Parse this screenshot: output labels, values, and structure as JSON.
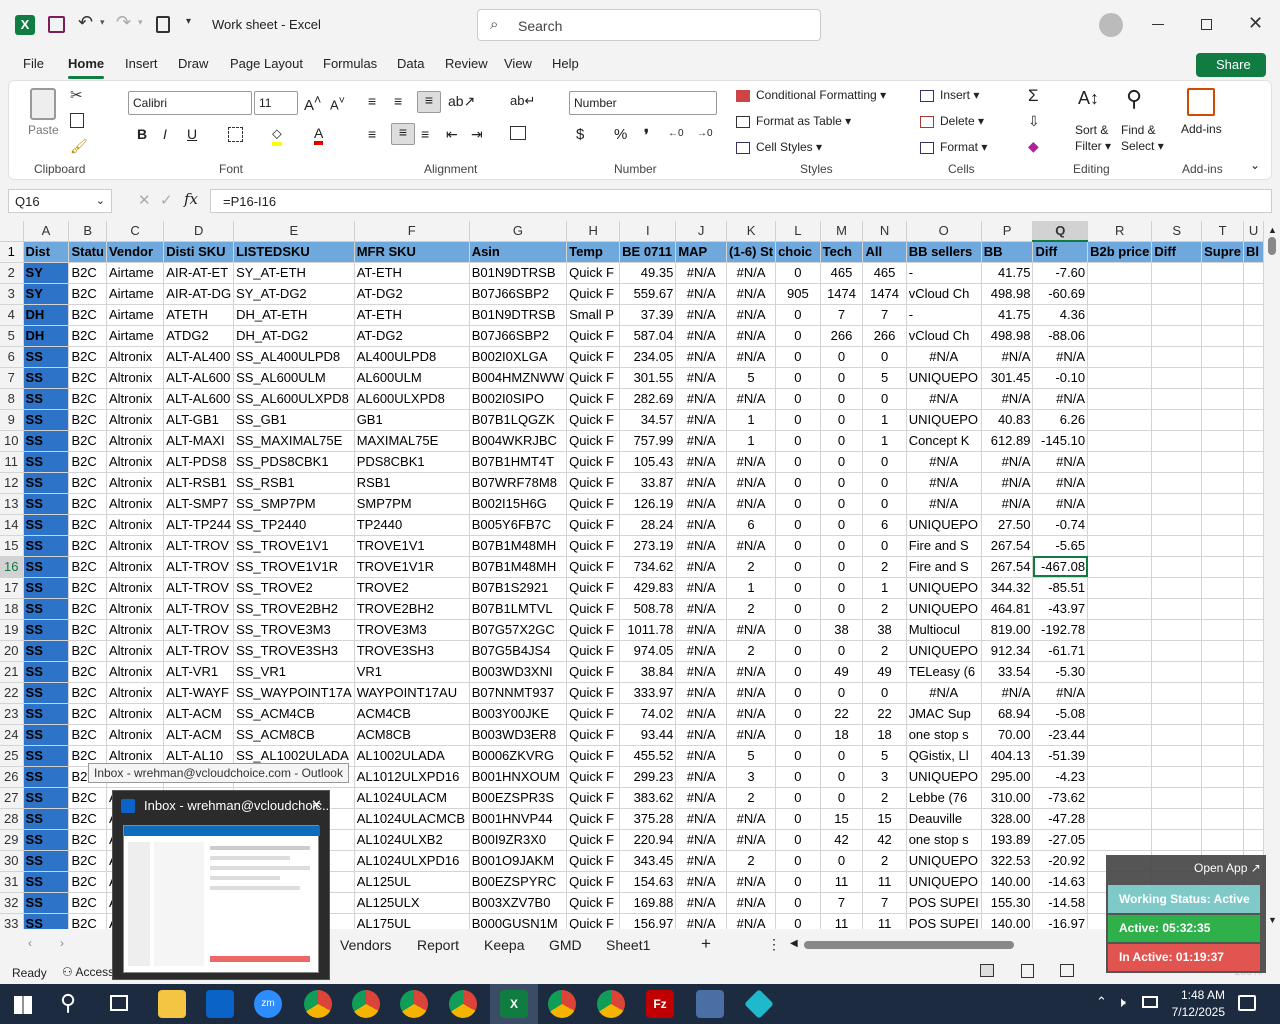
{
  "titlebar": {
    "doc_title": "Work sheet  -  Excel",
    "search_placeholder": "Search"
  },
  "menu": [
    "File",
    "Home",
    "Insert",
    "Draw",
    "Page Layout",
    "Formulas",
    "Data",
    "Review",
    "View",
    "Help"
  ],
  "share": "Share",
  "ribbon": {
    "paste": "Paste",
    "font_name": "Calibri",
    "font_size": "11",
    "number_format": "Number",
    "cond_fmt": "Conditional Formatting",
    "fmt_table": "Format as Table",
    "cell_styles": "Cell Styles",
    "insert": "Insert",
    "delete": "Delete",
    "format": "Format",
    "sort": "Sort &",
    "filter": "Filter",
    "find": "Find &",
    "select": "Select",
    "addins": "Add-ins",
    "groups": {
      "clipboard": "Clipboard",
      "font": "Font",
      "alignment": "Alignment",
      "number": "Number",
      "styles": "Styles",
      "cells": "Cells",
      "editing": "Editing",
      "addins": "Add-ins"
    }
  },
  "formula_bar": {
    "name_box": "Q16",
    "formula": "=P16-I16"
  },
  "columns": [
    "A",
    "B",
    "C",
    "D",
    "E",
    "F",
    "G",
    "H",
    "I",
    "J",
    "K",
    "L",
    "M",
    "N",
    "O",
    "P",
    "Q",
    "R",
    "S",
    "T",
    "U"
  ],
  "header_row": [
    "Dist",
    "Statu",
    "Vendor",
    "Disti SKU",
    "LISTEDSKU",
    "MFR SKU",
    "Asin",
    "Temp",
    "BE 0711",
    "MAP",
    "(1-6) St",
    "choic",
    "Tech",
    "All",
    "BB sellers",
    "BB",
    "Diff",
    "B2b price",
    "Diff",
    "Supre",
    "Bl"
  ],
  "rows": [
    [
      "SY",
      "B2C",
      "Airtame",
      "AIR-AT-ET",
      "SY_AT-ETH",
      "AT-ETH",
      "B01N9DTRSB",
      "Quick F",
      "49.35",
      "#N/A",
      "#N/A",
      "0",
      "465",
      "465",
      "-",
      "41.75",
      "-7.60"
    ],
    [
      "SY",
      "B2C",
      "Airtame",
      "AIR-AT-DG",
      "SY_AT-DG2",
      "AT-DG2",
      "B07J66SBP2",
      "Quick F",
      "559.67",
      "#N/A",
      "#N/A",
      "905",
      "1474",
      "1474",
      "vCloud Ch",
      "498.98",
      "-60.69"
    ],
    [
      "DH",
      "B2C",
      "Airtame",
      "ATETH",
      "DH_AT-ETH",
      "AT-ETH",
      "B01N9DTRSB",
      "Small P",
      "37.39",
      "#N/A",
      "#N/A",
      "0",
      "7",
      "7",
      "-",
      "41.75",
      "4.36"
    ],
    [
      "DH",
      "B2C",
      "Airtame",
      "ATDG2",
      "DH_AT-DG2",
      "AT-DG2",
      "B07J66SBP2",
      "Quick F",
      "587.04",
      "#N/A",
      "#N/A",
      "0",
      "266",
      "266",
      "vCloud Ch",
      "498.98",
      "-88.06"
    ],
    [
      "SS",
      "B2C",
      "Altronix",
      "ALT-AL400",
      "SS_AL400ULPD8",
      "AL400ULPD8",
      "B002I0XLGA",
      "Quick F",
      "234.05",
      "#N/A",
      "#N/A",
      "0",
      "0",
      "0",
      "#N/A",
      "#N/A",
      "#N/A"
    ],
    [
      "SS",
      "B2C",
      "Altronix",
      "ALT-AL600",
      "SS_AL600ULM",
      "AL600ULM",
      "B004HMZNWW",
      "Quick F",
      "301.55",
      "#N/A",
      "5",
      "0",
      "0",
      "5",
      "UNIQUEPO",
      "301.45",
      "-0.10"
    ],
    [
      "SS",
      "B2C",
      "Altronix",
      "ALT-AL600",
      "SS_AL600ULXPD8",
      "AL600ULXPD8",
      "B002I0SIPO",
      "Quick F",
      "282.69",
      "#N/A",
      "#N/A",
      "0",
      "0",
      "0",
      "#N/A",
      "#N/A",
      "#N/A"
    ],
    [
      "SS",
      "B2C",
      "Altronix",
      "ALT-GB1",
      "SS_GB1",
      "GB1",
      "B07B1LQGZK",
      "Quick F",
      "34.57",
      "#N/A",
      "1",
      "0",
      "0",
      "1",
      "UNIQUEPO",
      "40.83",
      "6.26"
    ],
    [
      "SS",
      "B2C",
      "Altronix",
      "ALT-MAXI",
      "SS_MAXIMAL75E",
      "MAXIMAL75E",
      "B004WKRJBC",
      "Quick F",
      "757.99",
      "#N/A",
      "1",
      "0",
      "0",
      "1",
      "Concept K",
      "612.89",
      "-145.10"
    ],
    [
      "SS",
      "B2C",
      "Altronix",
      "ALT-PDS8",
      "SS_PDS8CBK1",
      "PDS8CBK1",
      "B07B1HMT4T",
      "Quick F",
      "105.43",
      "#N/A",
      "#N/A",
      "0",
      "0",
      "0",
      "#N/A",
      "#N/A",
      "#N/A"
    ],
    [
      "SS",
      "B2C",
      "Altronix",
      "ALT-RSB1",
      "SS_RSB1",
      "RSB1",
      "B07WRF78M8",
      "Quick F",
      "33.87",
      "#N/A",
      "#N/A",
      "0",
      "0",
      "0",
      "#N/A",
      "#N/A",
      "#N/A"
    ],
    [
      "SS",
      "B2C",
      "Altronix",
      "ALT-SMP7",
      "SS_SMP7PM",
      "SMP7PM",
      "B002I15H6G",
      "Quick F",
      "126.19",
      "#N/A",
      "#N/A",
      "0",
      "0",
      "0",
      "#N/A",
      "#N/A",
      "#N/A"
    ],
    [
      "SS",
      "B2C",
      "Altronix",
      "ALT-TP244",
      "SS_TP2440",
      "TP2440",
      "B005Y6FB7C",
      "Quick F",
      "28.24",
      "#N/A",
      "6",
      "0",
      "0",
      "6",
      "UNIQUEPO",
      "27.50",
      "-0.74"
    ],
    [
      "SS",
      "B2C",
      "Altronix",
      "ALT-TROV",
      "SS_TROVE1V1",
      "TROVE1V1",
      "B07B1M48MH",
      "Quick F",
      "273.19",
      "#N/A",
      "#N/A",
      "0",
      "0",
      "0",
      "Fire and S",
      "267.54",
      "-5.65"
    ],
    [
      "SS",
      "B2C",
      "Altronix",
      "ALT-TROV",
      "SS_TROVE1V1R",
      "TROVE1V1R",
      "B07B1M48MH",
      "Quick F",
      "734.62",
      "#N/A",
      "2",
      "0",
      "0",
      "2",
      "Fire and S",
      "267.54",
      "-467.08"
    ],
    [
      "SS",
      "B2C",
      "Altronix",
      "ALT-TROV",
      "SS_TROVE2",
      "TROVE2",
      "B07B1S2921",
      "Quick F",
      "429.83",
      "#N/A",
      "1",
      "0",
      "0",
      "1",
      "UNIQUEPO",
      "344.32",
      "-85.51"
    ],
    [
      "SS",
      "B2C",
      "Altronix",
      "ALT-TROV",
      "SS_TROVE2BH2",
      "TROVE2BH2",
      "B07B1LMTVL",
      "Quick F",
      "508.78",
      "#N/A",
      "2",
      "0",
      "0",
      "2",
      "UNIQUEPO",
      "464.81",
      "-43.97"
    ],
    [
      "SS",
      "B2C",
      "Altronix",
      "ALT-TROV",
      "SS_TROVE3M3",
      "TROVE3M3",
      "B07G57X2GC",
      "Quick F",
      "1011.78",
      "#N/A",
      "#N/A",
      "0",
      "38",
      "38",
      "Multiocul",
      "819.00",
      "-192.78"
    ],
    [
      "SS",
      "B2C",
      "Altronix",
      "ALT-TROV",
      "SS_TROVE3SH3",
      "TROVE3SH3",
      "B07G5B4JS4",
      "Quick F",
      "974.05",
      "#N/A",
      "2",
      "0",
      "0",
      "2",
      "UNIQUEPO",
      "912.34",
      "-61.71"
    ],
    [
      "SS",
      "B2C",
      "Altronix",
      "ALT-VR1",
      "SS_VR1",
      "VR1",
      "B003WD3XNI",
      "Quick F",
      "38.84",
      "#N/A",
      "#N/A",
      "0",
      "49",
      "49",
      "TELeasy (6",
      "33.54",
      "-5.30"
    ],
    [
      "SS",
      "B2C",
      "Altronix",
      "ALT-WAYF",
      "SS_WAYPOINT17A",
      "WAYPOINT17AU",
      "B07NNMT937",
      "Quick F",
      "333.97",
      "#N/A",
      "#N/A",
      "0",
      "0",
      "0",
      "#N/A",
      "#N/A",
      "#N/A"
    ],
    [
      "SS",
      "B2C",
      "Altronix",
      "ALT-ACM",
      "SS_ACM4CB",
      "ACM4CB",
      "B003Y00JKE",
      "Quick F",
      "74.02",
      "#N/A",
      "#N/A",
      "0",
      "22",
      "22",
      "JMAC Sup",
      "68.94",
      "-5.08"
    ],
    [
      "SS",
      "B2C",
      "Altronix",
      "ALT-ACM",
      "SS_ACM8CB",
      "ACM8CB",
      "B003WD3ER8",
      "Quick F",
      "93.44",
      "#N/A",
      "#N/A",
      "0",
      "18",
      "18",
      "one stop s",
      "70.00",
      "-23.44"
    ],
    [
      "SS",
      "B2C",
      "Altronix",
      "ALT-AL10",
      "SS_AL1002ULADA",
      "AL1002ULADA",
      "B0006ZKVRG",
      "Quick F",
      "455.52",
      "#N/A",
      "5",
      "0",
      "0",
      "5",
      "QGistix, Ll",
      "404.13",
      "-51.39"
    ],
    [
      "SS",
      "B2C",
      "",
      "",
      "",
      "AL1012ULXPD16",
      "B001HNXOUM",
      "Quick F",
      "299.23",
      "#N/A",
      "3",
      "0",
      "0",
      "3",
      "UNIQUEPO",
      "295.00",
      "-4.23"
    ],
    [
      "SS",
      "B2C",
      "Alt",
      "",
      "",
      "AL1024ULACM",
      "B00EZSPR3S",
      "Quick F",
      "383.62",
      "#N/A",
      "2",
      "0",
      "0",
      "2",
      "Lebbe (76",
      "310.00",
      "-73.62"
    ],
    [
      "SS",
      "B2C",
      "Alt",
      "",
      "",
      "AL1024ULACMCB",
      "B001HNVP44",
      "Quick F",
      "375.28",
      "#N/A",
      "#N/A",
      "0",
      "15",
      "15",
      "Deauville",
      "328.00",
      "-47.28"
    ],
    [
      "SS",
      "B2C",
      "Alt",
      "",
      "",
      "AL1024ULXB2",
      "B00I9ZR3X0",
      "Quick F",
      "220.94",
      "#N/A",
      "#N/A",
      "0",
      "42",
      "42",
      "one stop s",
      "193.89",
      "-27.05"
    ],
    [
      "SS",
      "B2C",
      "Alt",
      "",
      "",
      "AL1024ULXPD16",
      "B001O9JAKM",
      "Quick F",
      "343.45",
      "#N/A",
      "2",
      "0",
      "0",
      "2",
      "UNIQUEPO",
      "322.53",
      "-20.92"
    ],
    [
      "SS",
      "B2C",
      "Alt",
      "",
      "",
      "AL125UL",
      "B00EZSPYRC",
      "Quick F",
      "154.63",
      "#N/A",
      "#N/A",
      "0",
      "11",
      "11",
      "UNIQUEPO",
      "140.00",
      "-14.63"
    ],
    [
      "SS",
      "B2C",
      "Alt",
      "",
      "",
      "AL125ULX",
      "B003XZV7B0",
      "Quick F",
      "169.88",
      "#N/A",
      "#N/A",
      "0",
      "7",
      "7",
      "POS SUPEI",
      "155.30",
      "-14.58"
    ],
    [
      "SS",
      "B2C",
      "Alt",
      "",
      "",
      "AL175UL",
      "B000GUSN1M",
      "Quick F",
      "156.97",
      "#N/A",
      "#N/A",
      "0",
      "11",
      "11",
      "POS SUPEI",
      "140.00",
      "-16.97"
    ]
  ],
  "sheets": [
    "Vendors",
    "Report",
    "Keepa",
    "GMD",
    "Sheet1"
  ],
  "status": {
    "ready": "Ready",
    "access": "Access",
    "zoom": "100%"
  },
  "outlook": {
    "tooltip": "Inbox - wrehman@vcloudchoice.com - Outlook",
    "thumb_title": "Inbox - wrehman@vcloudchoic..."
  },
  "tracker": {
    "open_app": "Open App ↗",
    "working": "Working Status: Active",
    "active": "Active: 05:32:35",
    "inactive": "In Active: 01:19:37"
  },
  "clock": {
    "time": "1:48 AM",
    "date": "7/12/2025"
  }
}
